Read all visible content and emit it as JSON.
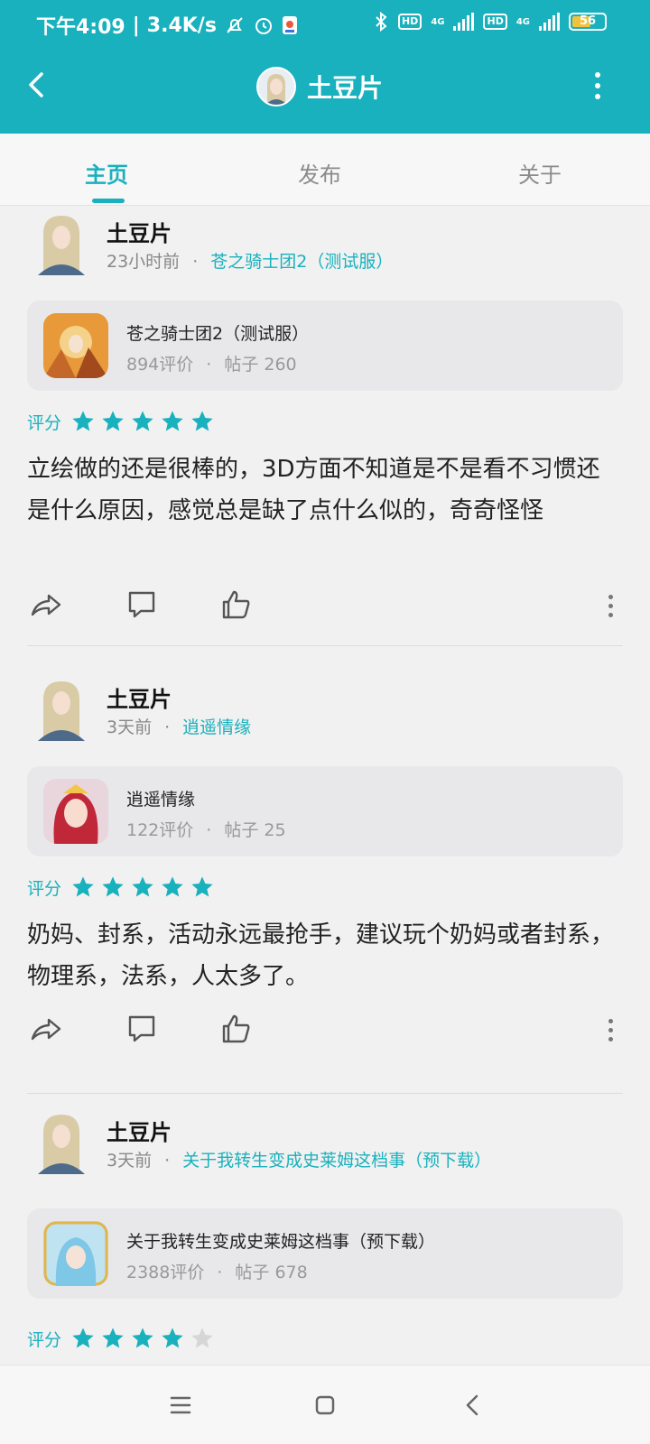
{
  "status_bar": {
    "time": "下午4:09",
    "speed": "3.4K/s",
    "hd1": "HD",
    "hd2": "HD",
    "net1": "4G",
    "net2": "4G",
    "battery": "56"
  },
  "header": {
    "title": "土豆片",
    "accent": "#19b1bd"
  },
  "tabs": [
    {
      "label": "主页",
      "active": true
    },
    {
      "label": "发布",
      "active": false
    },
    {
      "label": "关于",
      "active": false
    }
  ],
  "posts": [
    {
      "user": "土豆片",
      "time": "23小时前",
      "game_link": "苍之骑士团2（测试服）",
      "card": {
        "name": "苍之骑士团2（测试服）",
        "reviews": "894评价",
        "posts": "帖子 260"
      },
      "rating_label": "评分",
      "stars": 5,
      "text": "立绘做的还是很棒的，3D方面不知道是不是看不习惯还是什么原因，感觉总是缺了点什么似的，奇奇怪怪"
    },
    {
      "user": "土豆片",
      "time": "3天前",
      "game_link": "逍遥情缘",
      "card": {
        "name": "逍遥情缘",
        "reviews": "122评价",
        "posts": "帖子 25"
      },
      "rating_label": "评分",
      "stars": 5,
      "text": "奶妈、封系，活动永远最抢手，建议玩个奶妈或者封系，物理系，法系，人太多了。"
    },
    {
      "user": "土豆片",
      "time": "3天前",
      "game_link": "关于我转生变成史莱姆这档事（预下载）",
      "card": {
        "name": "关于我转生变成史莱姆这档事（预下载）",
        "reviews": "2388评价",
        "posts": "帖子 678"
      },
      "rating_label": "评分",
      "stars": 4
    }
  ],
  "separator_dot": "·",
  "star_colors": {
    "filled": "#19b1bd",
    "empty": "#d6d6d6"
  }
}
